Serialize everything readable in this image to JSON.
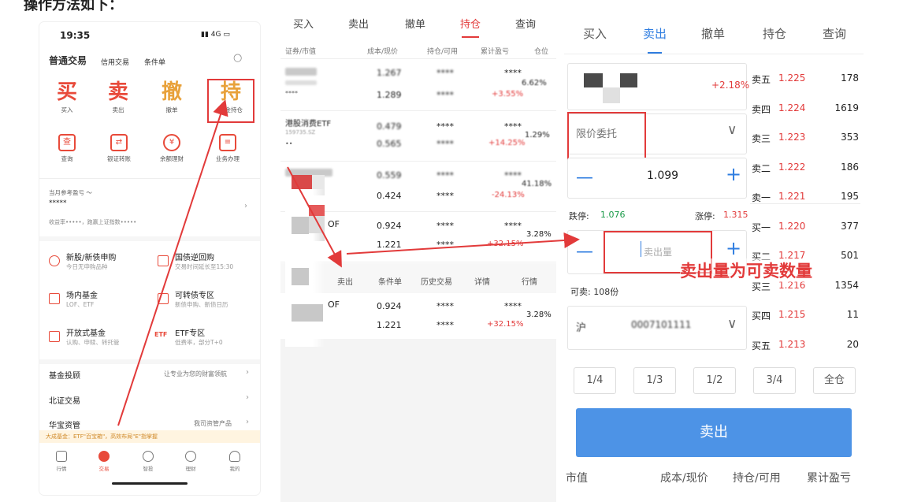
{
  "page_heading": "操作方法如下：",
  "panel1": {
    "status_time": "19:35",
    "status_network": "4G",
    "tabs": [
      "普通交易",
      "信用交易",
      "条件单"
    ],
    "big_actions": [
      {
        "glyph": "买",
        "label": "买入"
      },
      {
        "glyph": "卖",
        "label": "卖出"
      },
      {
        "glyph": "撤",
        "label": "撤单"
      },
      {
        "glyph": "持",
        "label": "资金持仓"
      }
    ],
    "small_actions": [
      {
        "icon": "查",
        "label": "查询"
      },
      {
        "icon": "⇄",
        "label": "银证转账"
      },
      {
        "icon": "¥",
        "label": "余额理财"
      },
      {
        "icon": "≡",
        "label": "业务办理"
      }
    ],
    "profit_title": "当月参考盈亏 ～",
    "profit_value": "*****",
    "profit_detail": "收益率•••••，跑赢上证指数•••••",
    "menu": [
      {
        "title": "新股/新债申购",
        "sub": "今日无申购品种"
      },
      {
        "title": "国债逆回购",
        "sub": "交易时间延长至15:30"
      },
      {
        "title": "场内基金",
        "sub": "LOF、ETF"
      },
      {
        "title": "可转债专区",
        "sub": "新债申购、新债日历"
      },
      {
        "title": "开放式基金",
        "sub": "认购、申赎、转托管"
      },
      {
        "title": "ETF专区",
        "sub": "低费率，部分T+0"
      }
    ],
    "etf_badge": "ETF",
    "rows": [
      {
        "title": "基金投顾",
        "right": "让专业为您的财富领航"
      },
      {
        "title": "北证交易",
        "right": ""
      },
      {
        "title": "华宝资管",
        "right": "我司资管产品"
      }
    ],
    "marquee": "大成基金：ETF\"百宝箱\"，高效布局\"E\"指掌握",
    "bottom_nav": [
      "行情",
      "交易",
      "智投",
      "理财",
      "我的"
    ]
  },
  "panel2": {
    "tabs": [
      "买入",
      "卖出",
      "撤单",
      "持仓",
      "查询"
    ],
    "headers": [
      "证券/市值",
      "成本/现价",
      "持仓/可用",
      "累计盈亏",
      "仓位"
    ],
    "rows": [
      {
        "cost": "1.267",
        "price": "1.289",
        "hold": "****",
        "avail": "****",
        "profit": "****",
        "pct": "+3.55%",
        "pos": "6.62%"
      },
      {
        "name": "港股消费ETF",
        "sub": "159735.SZ",
        "cost": "0.479",
        "price": "0.565",
        "hold": "****",
        "avail": "****",
        "profit": "****",
        "pct": "+14.25%",
        "pos": "1.29%"
      },
      {
        "cost": "0.559",
        "price": "0.424",
        "hold": "****",
        "avail": "****",
        "profit": "****",
        "pct": "-24.13%",
        "pos": "41.18%"
      },
      {
        "name_suffix": "OF",
        "cost": "0.924",
        "price": "1.221",
        "hold": "****",
        "avail": "****",
        "profit": "****",
        "pct": "+32.15%",
        "pos": "3.28%"
      },
      {
        "name_suffix": "OF",
        "cost": "0.924",
        "price": "1.221",
        "hold": "****",
        "avail": "****",
        "profit": "****",
        "pct": "+32.15%",
        "pos": "3.28%"
      }
    ],
    "options": [
      "卖出",
      "条件单",
      "历史交易",
      "详情",
      "行情"
    ]
  },
  "panel3": {
    "tabs": [
      "买入",
      "卖出",
      "撤单",
      "持仓",
      "查询"
    ],
    "change_pct": "+2.18%",
    "order_type": "限价委托",
    "price": "1.099",
    "limit_down_label": "跌停:",
    "limit_down": "1.076",
    "limit_up_label": "涨停:",
    "limit_up": "1.315",
    "qty_placeholder": "卖出量",
    "available_label": "可卖:",
    "available_value": "108份",
    "account_prefix": "沪",
    "account_masked": "0007101111",
    "fractions": [
      "1/4",
      "1/3",
      "1/2",
      "3/4",
      "全仓"
    ],
    "sell_button": "卖出",
    "footer": [
      "市值",
      "成本/现价",
      "持仓/可用",
      "累计盈亏"
    ],
    "orderbook": [
      {
        "label": "卖五",
        "price": "1.225",
        "vol": "178"
      },
      {
        "label": "卖四",
        "price": "1.224",
        "vol": "1619"
      },
      {
        "label": "卖三",
        "price": "1.223",
        "vol": "353"
      },
      {
        "label": "卖二",
        "price": "1.222",
        "vol": "186"
      },
      {
        "label": "卖一",
        "price": "1.221",
        "vol": "195"
      },
      {
        "label": "买一",
        "price": "1.220",
        "vol": "377"
      },
      {
        "label": "买二",
        "price": "1.217",
        "vol": "501"
      },
      {
        "label": "买三",
        "price": "1.216",
        "vol": "1354"
      },
      {
        "label": "买四",
        "price": "1.215",
        "vol": "11"
      },
      {
        "label": "买五",
        "price": "1.213",
        "vol": "20"
      }
    ]
  },
  "annotation": "卖出量为可卖数量",
  "colors": {
    "accent_red": "#e23a3a",
    "sell_blue": "#4d93e6",
    "tab_blue": "#2f7de0",
    "green": "#1a9a48"
  }
}
